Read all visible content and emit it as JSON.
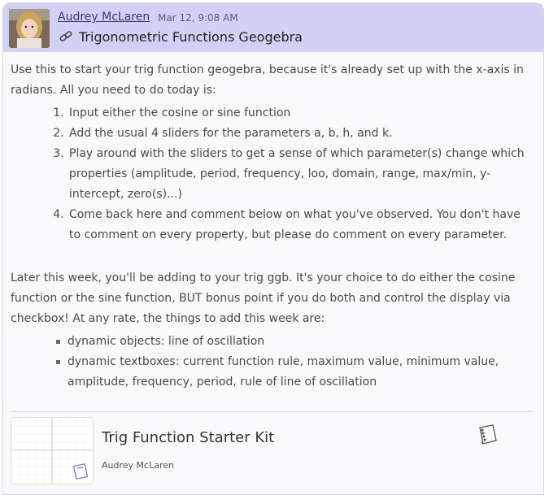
{
  "post": {
    "author": "Audrey McLaren",
    "timestamp": "Mar 12, 9:08 AM",
    "title": "Trigonometric Functions Geogebra",
    "title_icon": "geogebra-link-icon"
  },
  "body": {
    "intro": "Use this to start your trig function geogebra, because it's already set up with the x-axis in radians. All you need to do today is:",
    "steps": [
      "Input either the cosine or sine function",
      "Add the usual 4 sliders for the parameters a, b, h, and k.",
      "Play around with the sliders to get a sense of which parameter(s) change which properties (amplitude, period, frequency, loo, domain, range, max/min, y-intercept, zero(s)...)",
      "Come back here and comment below on what you've observed. You don't have to comment on every property, but please do comment on every parameter."
    ],
    "later": "Later this week, you'll be adding to your trig ggb. It's your choice to do either the cosine function or the sine function, BUT bonus point if you do both and control the display via checkbox! At any rate, the things to add this week are:",
    "bullets": [
      "dynamic objects: line of oscillation",
      "dynamic textboxes: current function rule, maximum value, minimum value, amplitude, frequency, period, rule of line of oscillation"
    ]
  },
  "resource": {
    "title": "Trig Function Starter Kit",
    "author": "Audrey McLaren",
    "icon": "book-icon"
  }
}
